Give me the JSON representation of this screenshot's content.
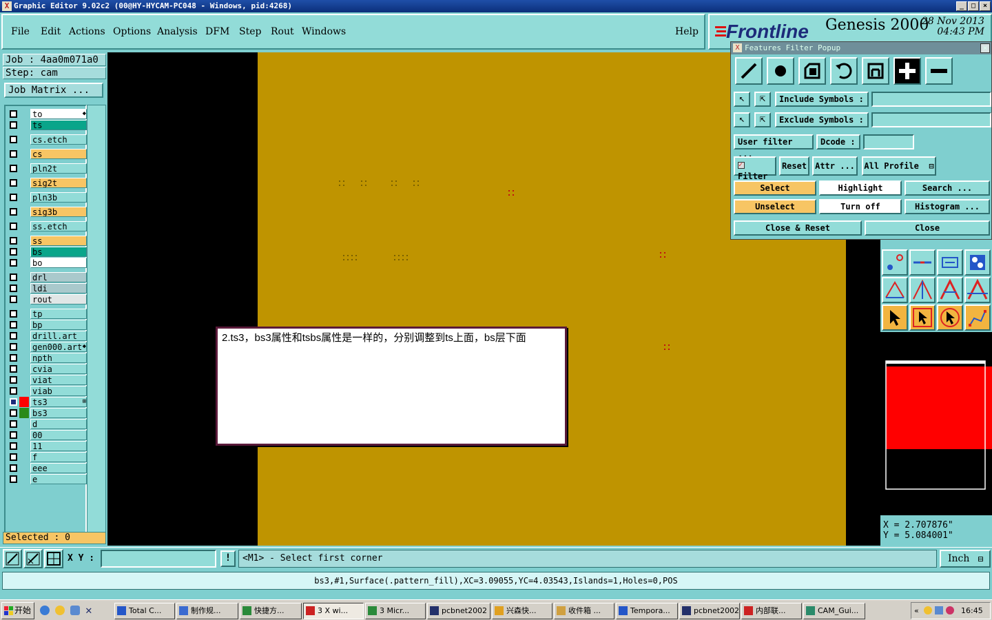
{
  "window": {
    "title": "Graphic Editor 9.02c2 (00@HY-HYCAM-PC048 - Windows, pid:4268)",
    "controls": [
      "_",
      "□",
      "×"
    ]
  },
  "menu": {
    "items": [
      "File",
      "Edit",
      "Actions",
      "Options",
      "Analysis",
      "DFM",
      "Step",
      "Rout",
      "Windows"
    ],
    "help": "Help"
  },
  "logo": {
    "brand": "Frontline",
    "product": "Genesis 2000",
    "date": "28 Nov 2013",
    "time": "04:43 PM"
  },
  "job": {
    "job_label": "Job : 4aa0m071a0",
    "step_label": "Step: cam",
    "matrix_button": "Job Matrix ...",
    "selected": "Selected : 0"
  },
  "layers": [
    {
      "name": "to",
      "bg": "#ffffff",
      "marker": "◆"
    },
    {
      "name": "ts",
      "bg": "#0aa58a"
    },
    {
      "name": "cs.etch",
      "bg": "#92dcd8"
    },
    {
      "name": "cs",
      "bg": "#f7c564"
    },
    {
      "name": "pln2t",
      "bg": "#92dcd8"
    },
    {
      "name": "sig2t",
      "bg": "#f7c564"
    },
    {
      "name": "pln3b",
      "bg": "#92dcd8"
    },
    {
      "name": "sig3b",
      "bg": "#f7c564"
    },
    {
      "name": "ss.etch",
      "bg": "#92dcd8"
    },
    {
      "name": "ss",
      "bg": "#f7c564"
    },
    {
      "name": "bs",
      "bg": "#0aa58a"
    },
    {
      "name": "bo",
      "bg": "#ffffff"
    },
    {
      "name": "drl",
      "bg": "#a9c9cc"
    },
    {
      "name": "ldi",
      "bg": "#a9c9cc"
    },
    {
      "name": "rout",
      "bg": "#e0e6e6"
    },
    {
      "name": "tp",
      "bg": "#92dcd8"
    },
    {
      "name": "bp",
      "bg": "#92dcd8"
    },
    {
      "name": "drill.art",
      "bg": "#92dcd8"
    },
    {
      "name": "gen000.art",
      "bg": "#92dcd8",
      "marker": "◆"
    },
    {
      "name": "npth",
      "bg": "#92dcd8"
    },
    {
      "name": "cvia",
      "bg": "#92dcd8"
    },
    {
      "name": "viat",
      "bg": "#92dcd8"
    },
    {
      "name": "viab",
      "bg": "#92dcd8"
    },
    {
      "name": "ts3",
      "bg": "#92dcd8",
      "swatch": "#ff0000",
      "active": true,
      "marker": "⊞"
    },
    {
      "name": "bs3",
      "bg": "#92dcd8",
      "swatch": "#2a8a1a"
    },
    {
      "name": "d",
      "bg": "#92dcd8"
    },
    {
      "name": "00",
      "bg": "#92dcd8"
    },
    {
      "name": "11",
      "bg": "#92dcd8"
    },
    {
      "name": "f",
      "bg": "#92dcd8"
    },
    {
      "name": "eee",
      "bg": "#92dcd8"
    },
    {
      "name": "e",
      "bg": "#92dcd8"
    }
  ],
  "message": {
    "text": "2.ts3，bs3属性和tsbs属性是一样的，分别调整到ts上面，bs层下面"
  },
  "features_filter": {
    "title": "Features Filter Popup",
    "include_label": "Include Symbols :",
    "exclude_label": "Exclude Symbols :",
    "user_filter": "User filter ...",
    "dcode_label": "Dcode :",
    "filter_label": "Filter",
    "reset": "Reset",
    "attr": "Attr ...",
    "profile": "All Profile",
    "select": "Select",
    "highlight": "Highlight",
    "search": "Search ...",
    "unselect": "Unselect",
    "turn_off": "Turn off",
    "histogram": "Histogram ...",
    "close_reset": "Close & Reset",
    "close": "Close"
  },
  "coords": {
    "x": "X = 2.707876\"",
    "y": "Y = 5.084001\""
  },
  "command": {
    "xy_label": "X Y :",
    "excl": "!",
    "prompt": "<M1> - Select first corner",
    "unit": "Inch"
  },
  "status": {
    "text": "bs3,#1,Surface(.pattern_fill),XC=3.09055,YC=4.03543,Islands=1,Holes=0,POS"
  },
  "taskbar": {
    "start": "开始",
    "items": [
      "Total C...",
      "制作规...",
      "快捷方...",
      "3 X wi...",
      "3 Micr...",
      "pcbnet2002",
      "兴森快...",
      "收件箱 ...",
      "Tempora...",
      "pcbnet2002",
      "内部联...",
      "CAM_Gui..."
    ],
    "clock": "16:45",
    "tray_arrow": "«"
  }
}
